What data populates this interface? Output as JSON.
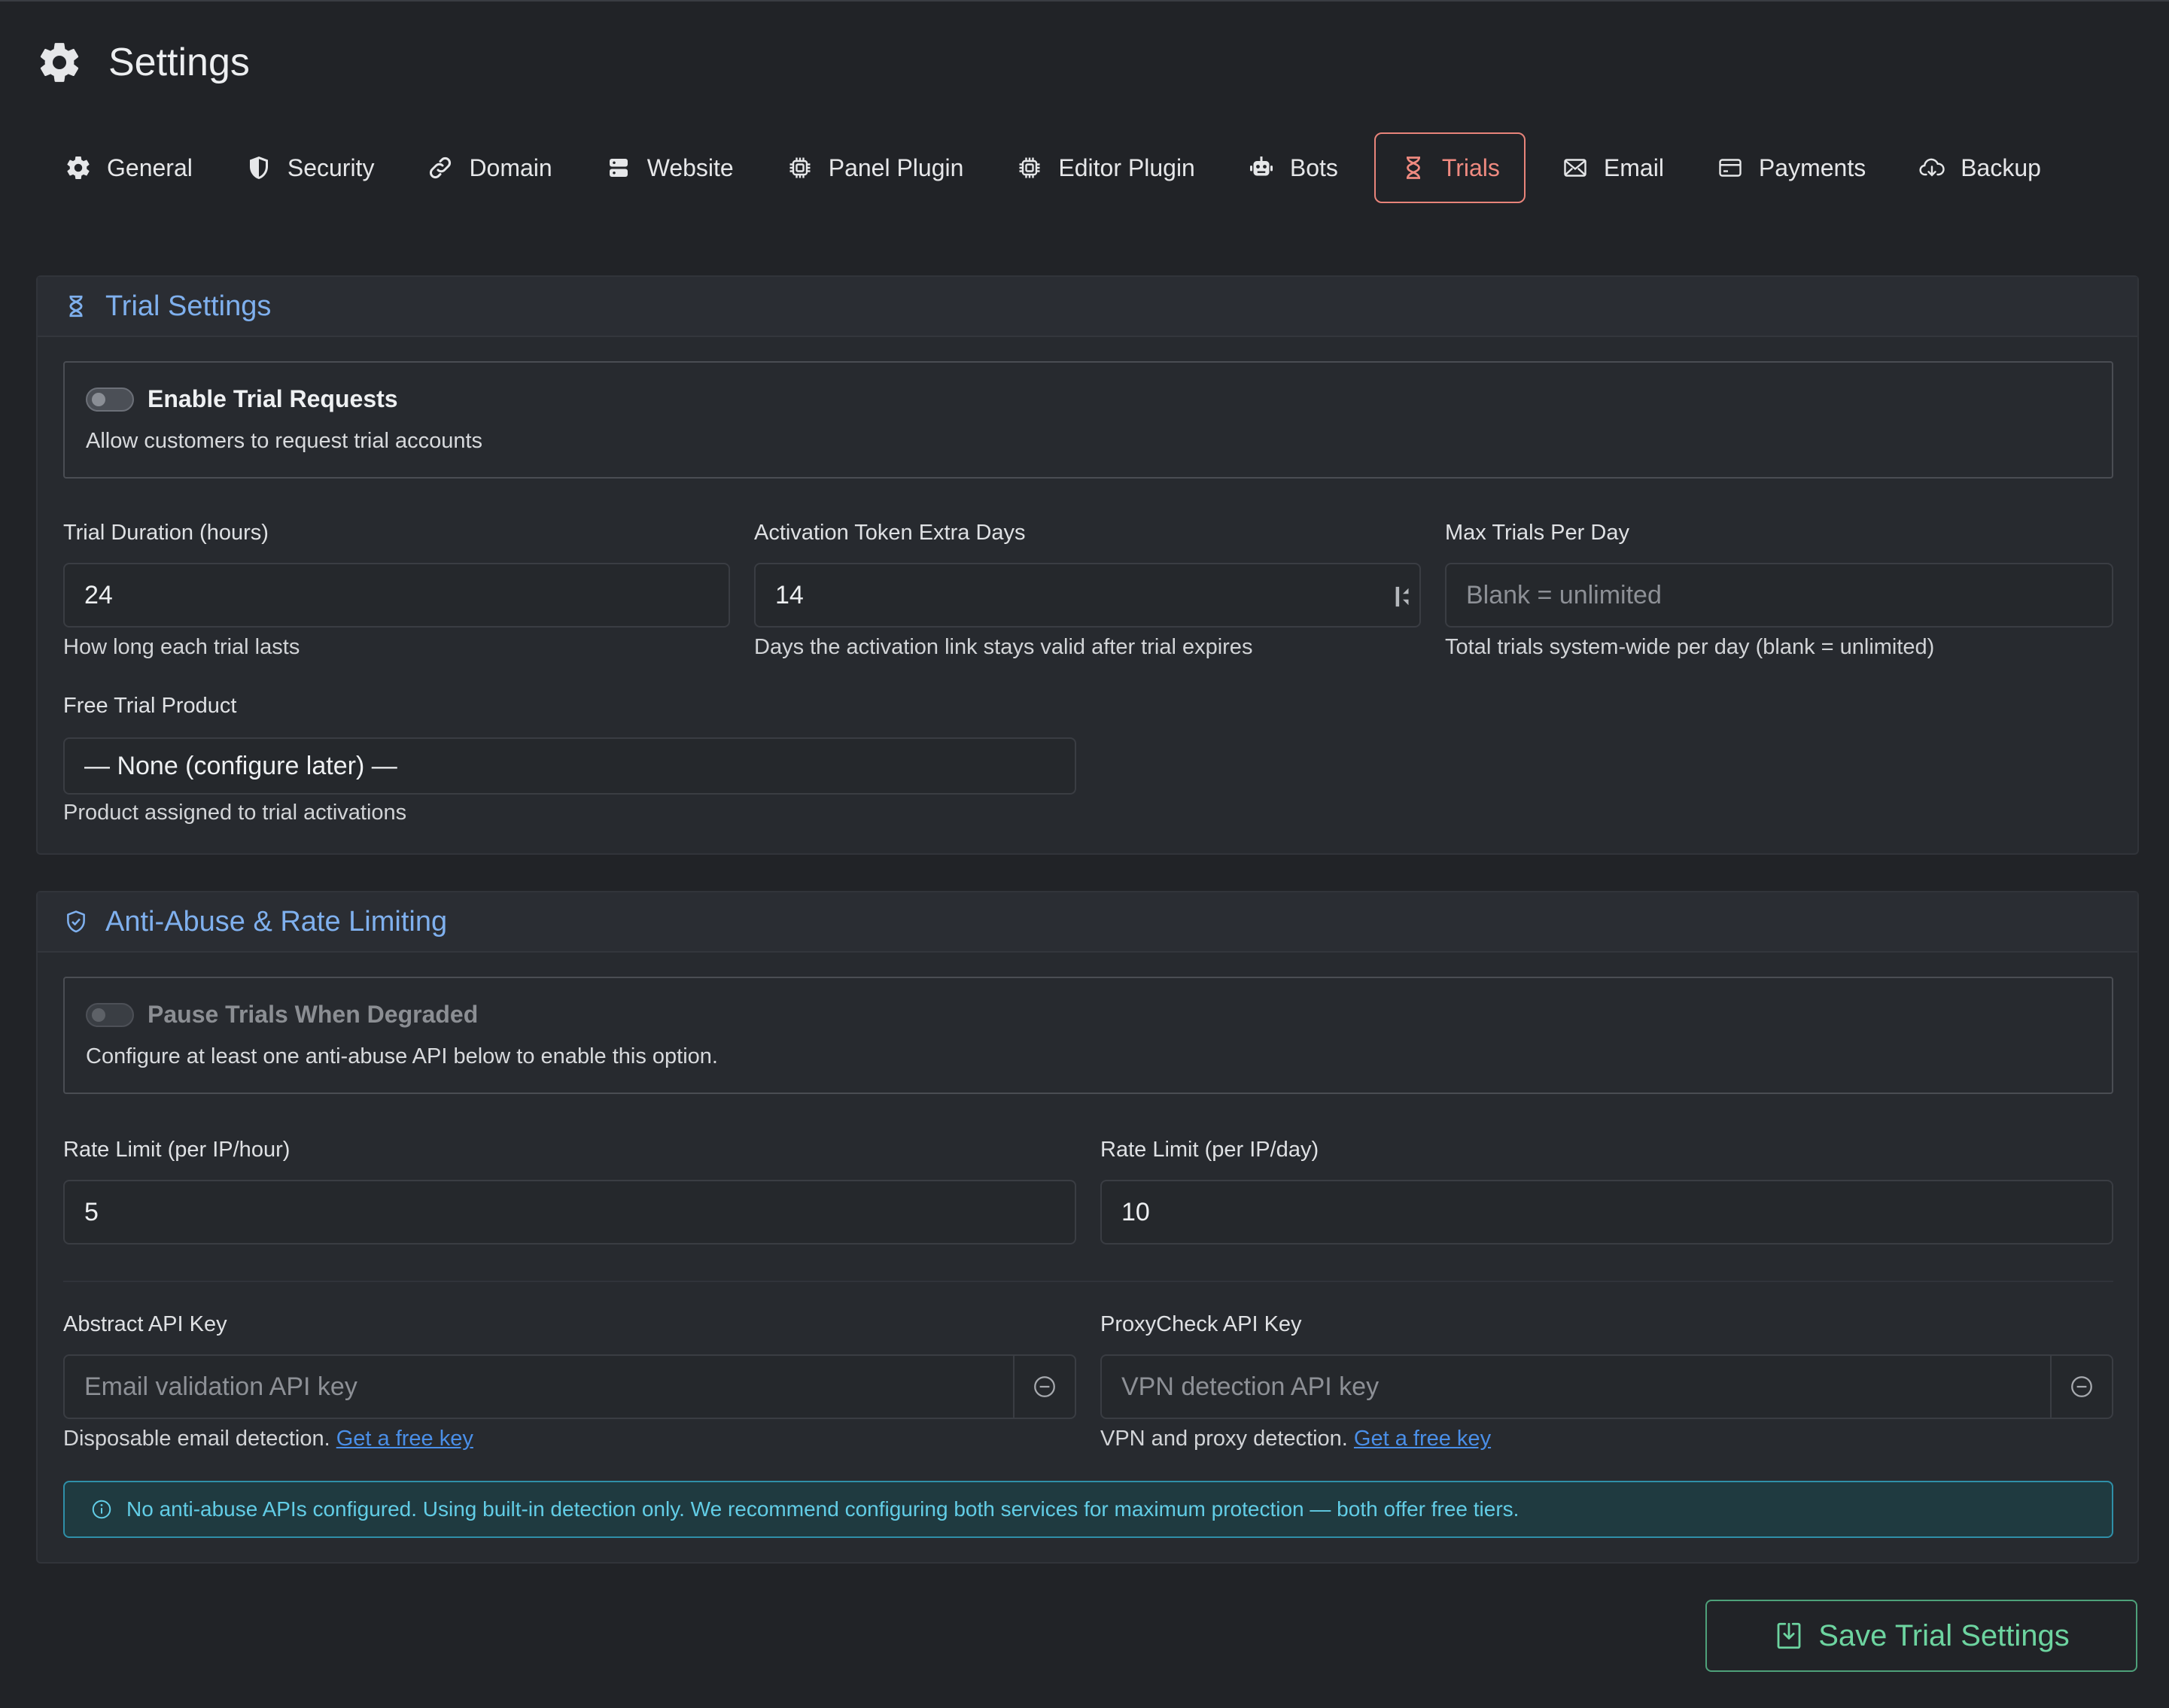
{
  "page": {
    "title": "Settings"
  },
  "tabs": [
    {
      "label": "General",
      "icon": "gear-icon"
    },
    {
      "label": "Security",
      "icon": "shield-icon"
    },
    {
      "label": "Domain",
      "icon": "link-icon"
    },
    {
      "label": "Website",
      "icon": "server-icon"
    },
    {
      "label": "Panel Plugin",
      "icon": "cpu-icon"
    },
    {
      "label": "Editor Plugin",
      "icon": "cpu-icon"
    },
    {
      "label": "Bots",
      "icon": "robot-icon"
    },
    {
      "label": "Trials",
      "icon": "hourglass-icon",
      "active": true
    },
    {
      "label": "Email",
      "icon": "envelope-icon"
    },
    {
      "label": "Payments",
      "icon": "credit-card-icon"
    },
    {
      "label": "Backup",
      "icon": "cloud-download-icon"
    }
  ],
  "trial_settings": {
    "title": "Trial Settings",
    "enable_toggle": {
      "title": "Enable Trial Requests",
      "description": "Allow customers to request trial accounts",
      "on": false
    },
    "duration": {
      "label": "Trial Duration (hours)",
      "value": "24",
      "help": "How long each trial lasts"
    },
    "token_days": {
      "label": "Activation Token Extra Days",
      "value": "14",
      "help": "Days the activation link stays valid after trial expires"
    },
    "max_trials": {
      "label": "Max Trials Per Day",
      "value": "",
      "placeholder": "Blank = unlimited",
      "help": "Total trials system-wide per day (blank = unlimited)"
    },
    "product": {
      "label": "Free Trial Product",
      "value": "— None (configure later) —",
      "help": "Product assigned to trial activations"
    }
  },
  "anti_abuse": {
    "title": "Anti-Abuse & Rate Limiting",
    "pause_toggle": {
      "title": "Pause Trials When Degraded",
      "description": "Configure at least one anti-abuse API below to enable this option.",
      "on": false,
      "disabled": true
    },
    "rate_hour": {
      "label": "Rate Limit (per IP/hour)",
      "value": "5"
    },
    "rate_day": {
      "label": "Rate Limit (per IP/day)",
      "value": "10"
    },
    "abstract_key": {
      "label": "Abstract API Key",
      "value": "",
      "placeholder": "Email validation API key",
      "help": "Disposable email detection.",
      "link": "Get a free key"
    },
    "proxycheck_key": {
      "label": "ProxyCheck API Key",
      "value": "",
      "placeholder": "VPN detection API key",
      "help": "VPN and proxy detection.",
      "link": "Get a free key"
    },
    "alert": "No anti-abuse APIs configured. Using built-in detection only. We recommend configuring both services for maximum protection — both offer free tiers."
  },
  "actions": {
    "save_label": "Save Trial Settings"
  },
  "colors": {
    "accent_active_tab": "#ef8a80",
    "section_title": "#7fb0ee",
    "info": "#62cde6",
    "save": "#6dd4a0",
    "link": "#4a8fe8"
  }
}
